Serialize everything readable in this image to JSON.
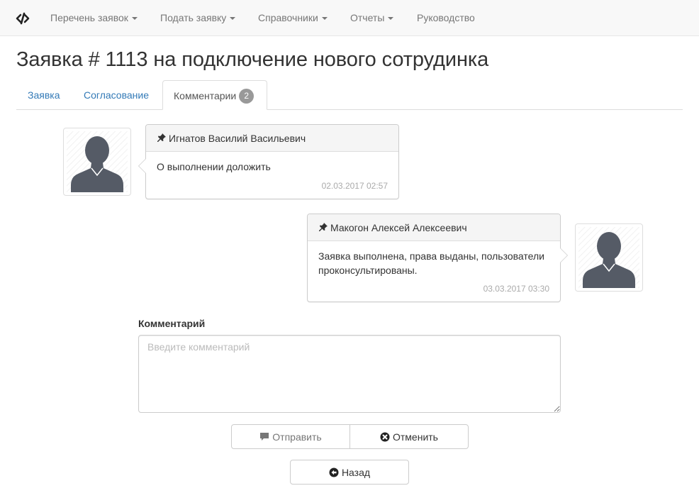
{
  "navbar": {
    "brand_icon": "code-slash-icon",
    "items": [
      {
        "label": "Перечень заявок",
        "dropdown": true
      },
      {
        "label": "Подать заявку",
        "dropdown": true
      },
      {
        "label": "Справочники",
        "dropdown": true
      },
      {
        "label": "Отчеты",
        "dropdown": true
      },
      {
        "label": "Руководство",
        "dropdown": false
      }
    ]
  },
  "page": {
    "title": "Заявка # 1113 на подключение нового сотрудинка"
  },
  "tabs": [
    {
      "label": "Заявка",
      "active": false
    },
    {
      "label": "Согласование",
      "active": false
    },
    {
      "label": "Комментарии",
      "active": true,
      "badge": "2"
    }
  ],
  "comments": [
    {
      "author": "Игнатов Василий Васильевич",
      "text": "О выполнении доложить",
      "time": "02.03.2017 02:57",
      "icon": "pushpin-icon"
    },
    {
      "author": "Макогон Алексей Алексеевич",
      "text": "Заявка выполнена, права выданы, пользователи проконсультированы.",
      "time": "03.03.2017 03:30",
      "icon": "pushpin-icon"
    }
  ],
  "form": {
    "label": "Комментарий",
    "placeholder": "Введите комментарий",
    "value": "",
    "send_label": "Отправить",
    "cancel_label": "Отменить",
    "back_label": "Назад"
  },
  "colors": {
    "link": "#337ab7",
    "navbar_bg": "#f8f8f8",
    "avatar_silhouette": "#555b66",
    "badge_bg": "#999999"
  }
}
